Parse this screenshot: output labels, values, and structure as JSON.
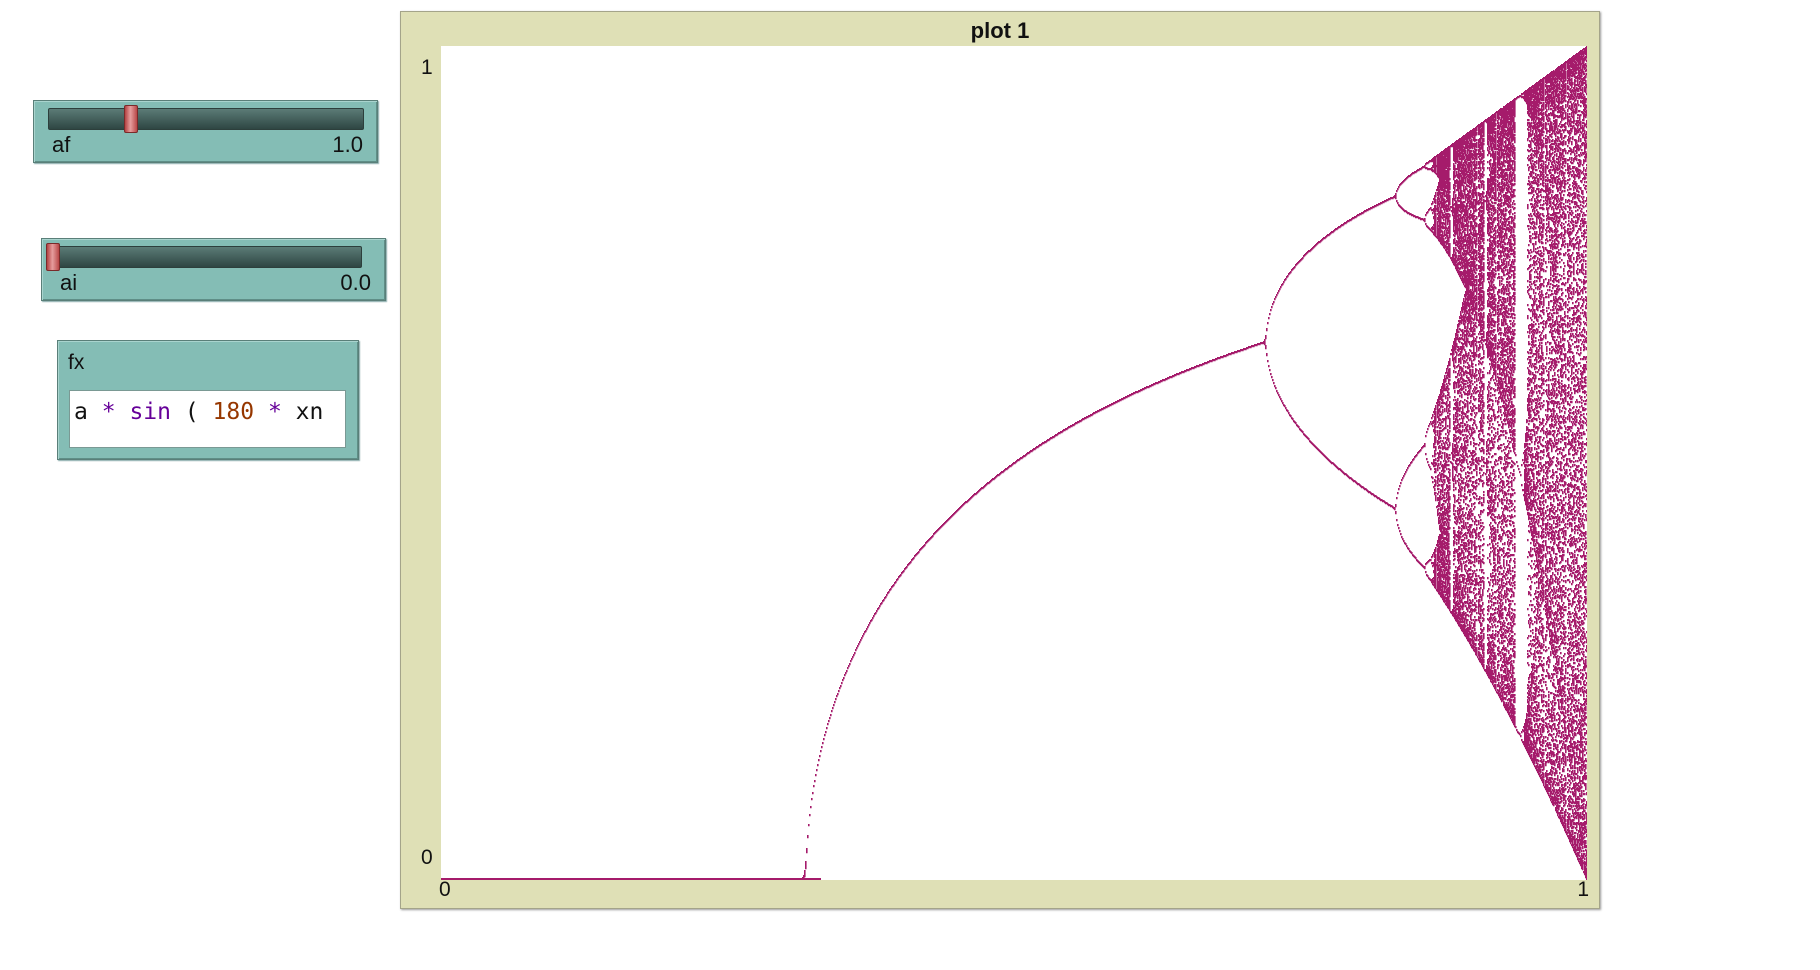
{
  "sliders": [
    {
      "name": "af",
      "value": "1.0",
      "position": 0.25
    },
    {
      "name": "ai",
      "value": "0.0",
      "position": 0.0
    }
  ],
  "input": {
    "name": "fx",
    "tokens": [
      {
        "text": "a",
        "kind": "var"
      },
      {
        "text": " ",
        "kind": "space"
      },
      {
        "text": "*",
        "kind": "prim"
      },
      {
        "text": " ",
        "kind": "space"
      },
      {
        "text": "sin",
        "kind": "prim"
      },
      {
        "text": " ( ",
        "kind": "var"
      },
      {
        "text": "180",
        "kind": "num"
      },
      {
        "text": " ",
        "kind": "space"
      },
      {
        "text": "*",
        "kind": "prim"
      },
      {
        "text": " xn",
        "kind": "var"
      }
    ]
  },
  "plot": {
    "title": "plot 1",
    "x_min_label": "0",
    "x_max_label": "1",
    "y_min_label": "0",
    "y_max_label": "1",
    "pen_color": "#a51b6b",
    "background": "#ffffff",
    "frame_color": "#dfe0b6"
  },
  "chart_data": {
    "type": "scatter",
    "title": "plot 1",
    "xlabel": "",
    "ylabel": "",
    "xlim": [
      0,
      1
    ],
    "ylim": [
      0,
      1
    ],
    "description_of_series": "bifurcation diagram of a * sin(180 * xn)",
    "segments": [
      {
        "a_start": 0.0,
        "a_end": 0.33,
        "kind": "fixed",
        "values": [
          0.0
        ]
      },
      {
        "a_start": 0.33,
        "a_end": 0.36,
        "kind": "band",
        "min": 0.0,
        "max": 0.27
      },
      {
        "a_start": 0.36,
        "a_end": 0.72,
        "kind": "fixed",
        "start": 0.27,
        "end": 0.64
      },
      {
        "a_start": 0.72,
        "a_end": 0.833,
        "kind": "period-2",
        "split_at": 0.64
      },
      {
        "a_start": 0.833,
        "a_end": 0.86,
        "kind": "period-4"
      },
      {
        "a_start": 0.86,
        "a_end": 1.0,
        "kind": "chaos",
        "top_at_end": 1.0,
        "bottom_at_end": 0.0
      }
    ]
  }
}
